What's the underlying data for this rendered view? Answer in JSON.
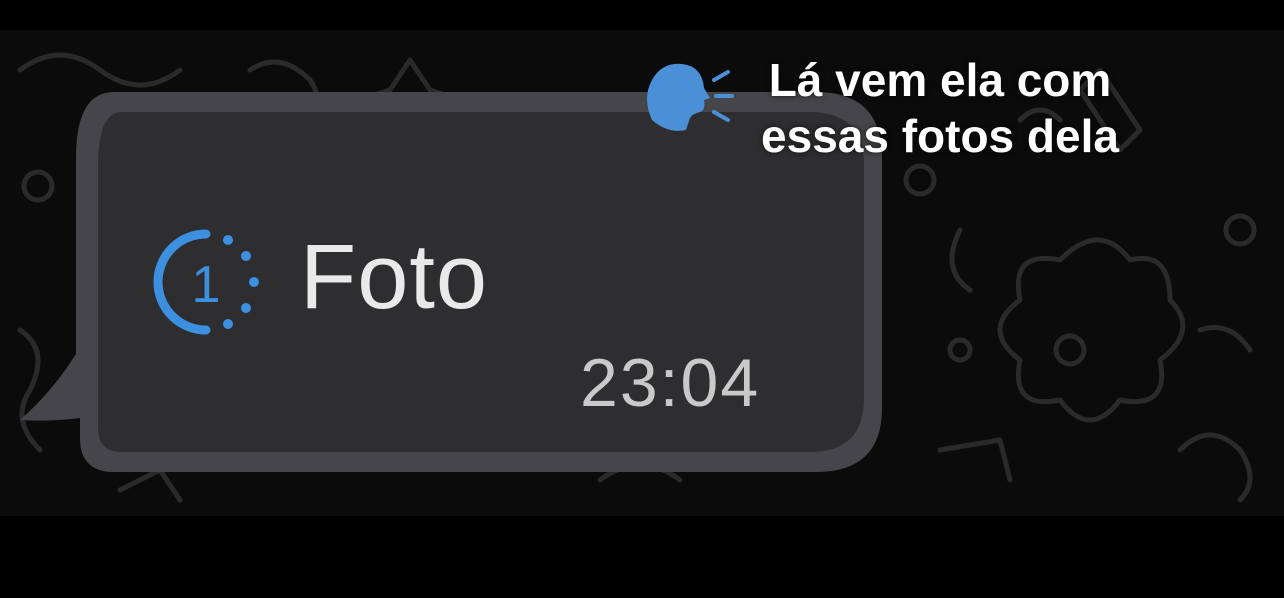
{
  "message": {
    "type_label": "Foto",
    "time": "23:04",
    "view_once_count": "1",
    "icon": "view-once-icon"
  },
  "overlay": {
    "caption_line_1": "Lá vem ela com",
    "caption_line_2": "essas fotos dela",
    "emoji": "speaking-head-icon"
  },
  "colors": {
    "accent": "#3d8fe0",
    "bubble": "#2e2e30",
    "background": "#0b0b0b",
    "text_primary": "#e9e9e9",
    "text_time": "#c9c9c9"
  }
}
